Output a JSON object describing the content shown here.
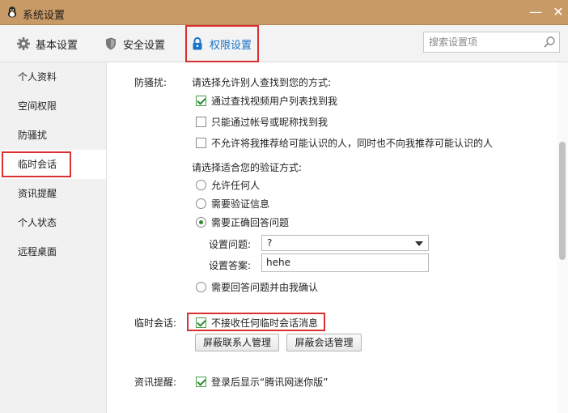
{
  "window": {
    "title": "系统设置",
    "minimize_glyph": "—",
    "close_glyph": "✕"
  },
  "toolbar": {
    "tabs": [
      {
        "label": "基本设置",
        "icon": "gear-icon"
      },
      {
        "label": "安全设置",
        "icon": "shield-icon"
      },
      {
        "label": "权限设置",
        "icon": "lock-icon",
        "active": true
      }
    ],
    "search_placeholder": "搜索设置项"
  },
  "sidebar": {
    "items": [
      {
        "label": "个人资料"
      },
      {
        "label": "空间权限"
      },
      {
        "label": "防骚扰"
      },
      {
        "label": "临时会话",
        "active": true
      },
      {
        "label": "资讯提醒"
      },
      {
        "label": "个人状态"
      },
      {
        "label": "远程桌面"
      }
    ]
  },
  "content": {
    "anti_harass": {
      "label": "防骚扰:",
      "find_prompt": "请选择允许别人查找到您的方式:",
      "find_options": [
        {
          "label": "通过查找视频用户列表找到我",
          "checked": true
        },
        {
          "label": "只能通过帐号或昵称找到我",
          "checked": false
        },
        {
          "label": "不允许将我推荐给可能认识的人，同时也不向我推荐可能认识的人",
          "checked": false
        }
      ],
      "verify_prompt": "请选择适合您的验证方式:",
      "verify_options": [
        {
          "label": "允许任何人",
          "selected": false
        },
        {
          "label": "需要验证信息",
          "selected": false
        },
        {
          "label": "需要正确回答问题",
          "selected": true
        },
        {
          "label": "需要回答问题并由我确认",
          "selected": false
        }
      ],
      "question_label": "设置问题:",
      "question_value": "?",
      "answer_label": "设置答案:",
      "answer_value": "hehe"
    },
    "temp_session": {
      "label": "临时会话:",
      "reject_label": "不接收任何临时会话消息",
      "reject_checked": true,
      "block_contacts_button": "屏蔽联系人管理",
      "block_sessions_button": "屏蔽会话管理"
    },
    "news": {
      "label": "资讯提醒:",
      "show_label": "登录后显示“腾讯网迷你版”",
      "show_checked": true
    }
  },
  "colors": {
    "titlebar": "#c89a66",
    "highlight": "#d93030",
    "active_tab_text": "#1a73c9",
    "check_green": "#2e8b2e"
  }
}
